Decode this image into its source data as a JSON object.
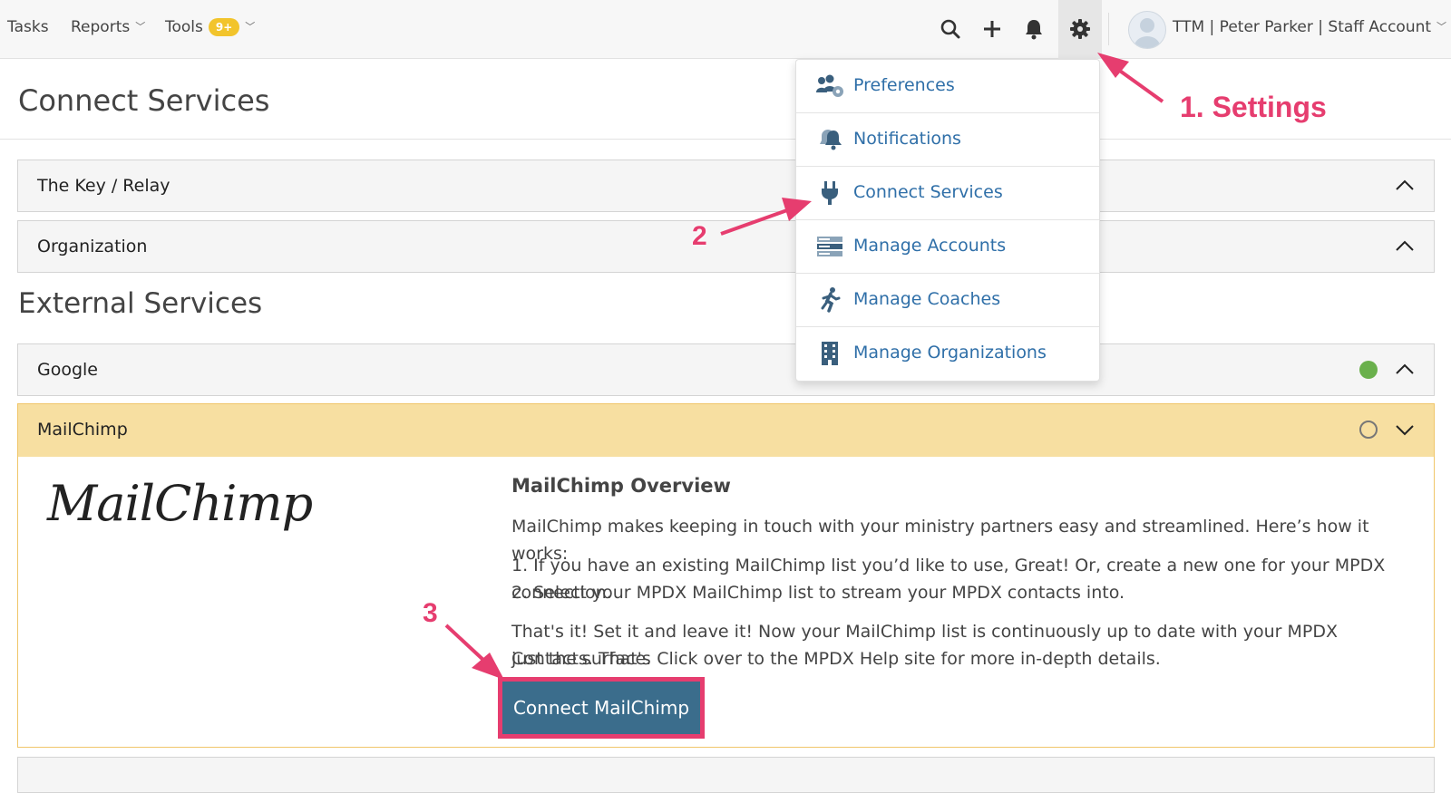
{
  "topnav": {
    "tasks": "Tasks",
    "reports": "Reports",
    "tools": "Tools",
    "tools_badge": "9+",
    "account": "TTM | Peter Parker | Staff Account"
  },
  "page": {
    "title": "Connect Services",
    "external_title": "External Services"
  },
  "panels": {
    "key_relay": "The Key / Relay",
    "organization": "Organization",
    "google": "Google",
    "mailchimp": "MailChimp"
  },
  "status_colors": {
    "connected": "#6ab04c",
    "disconnected": "#888888"
  },
  "mailchimp": {
    "logo_text": "MailChimp",
    "overview_title": "MailChimp Overview",
    "intro": "MailChimp makes keeping in touch with your ministry partners easy and streamlined. Here’s how it works:",
    "step1": "1. If you have an existing MailChimp list you’d like to use, Great! Or, create a new one for your MPDX connection.",
    "step2": "2. Select your MPDX MailChimp list to stream your MPDX contacts into.",
    "outro_line1": "That's it! Set it and leave it! Now your MailChimp list is continuously up to date with your MPDX Contacts. That's",
    "outro_line2": "just the surface. Click over to the MPDX Help site for more in-depth details.",
    "connect_button": "Connect MailChimp"
  },
  "settings_menu": {
    "items": [
      {
        "label": "Preferences",
        "icon": "preferences-icon"
      },
      {
        "label": "Notifications",
        "icon": "bells-icon"
      },
      {
        "label": "Connect Services",
        "icon": "plug-icon"
      },
      {
        "label": "Manage Accounts",
        "icon": "accounts-icon"
      },
      {
        "label": "Manage Coaches",
        "icon": "coach-icon"
      },
      {
        "label": "Manage Organizations",
        "icon": "building-icon"
      }
    ]
  },
  "annotations": {
    "settings": "1. Settings",
    "step2": "2",
    "step3": "3"
  }
}
